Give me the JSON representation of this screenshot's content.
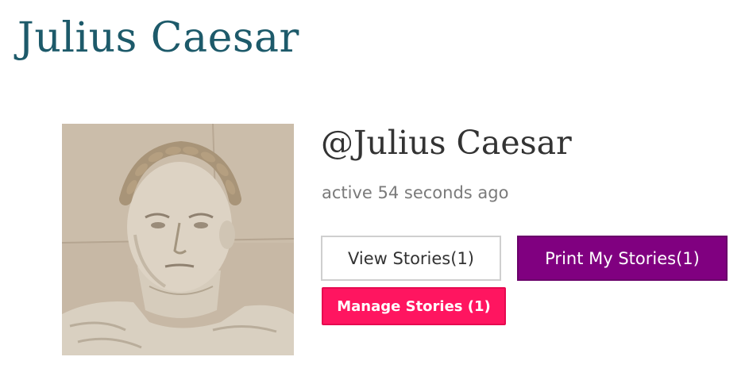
{
  "page": {
    "title": "Julius Caesar"
  },
  "profile": {
    "username": "@Julius Caesar",
    "activity": "active 54 seconds ago",
    "avatar": "bust-portrait-image"
  },
  "actions": {
    "view_stories_label": "View Stories(1)",
    "print_stories_label": "Print My Stories(1)",
    "manage_stories_label": "Manage Stories (1)"
  },
  "colors": {
    "title": "#1d5a6a",
    "print_button": "#800080",
    "manage_button": "#ff1560",
    "activity_text": "#7a7a7a"
  }
}
